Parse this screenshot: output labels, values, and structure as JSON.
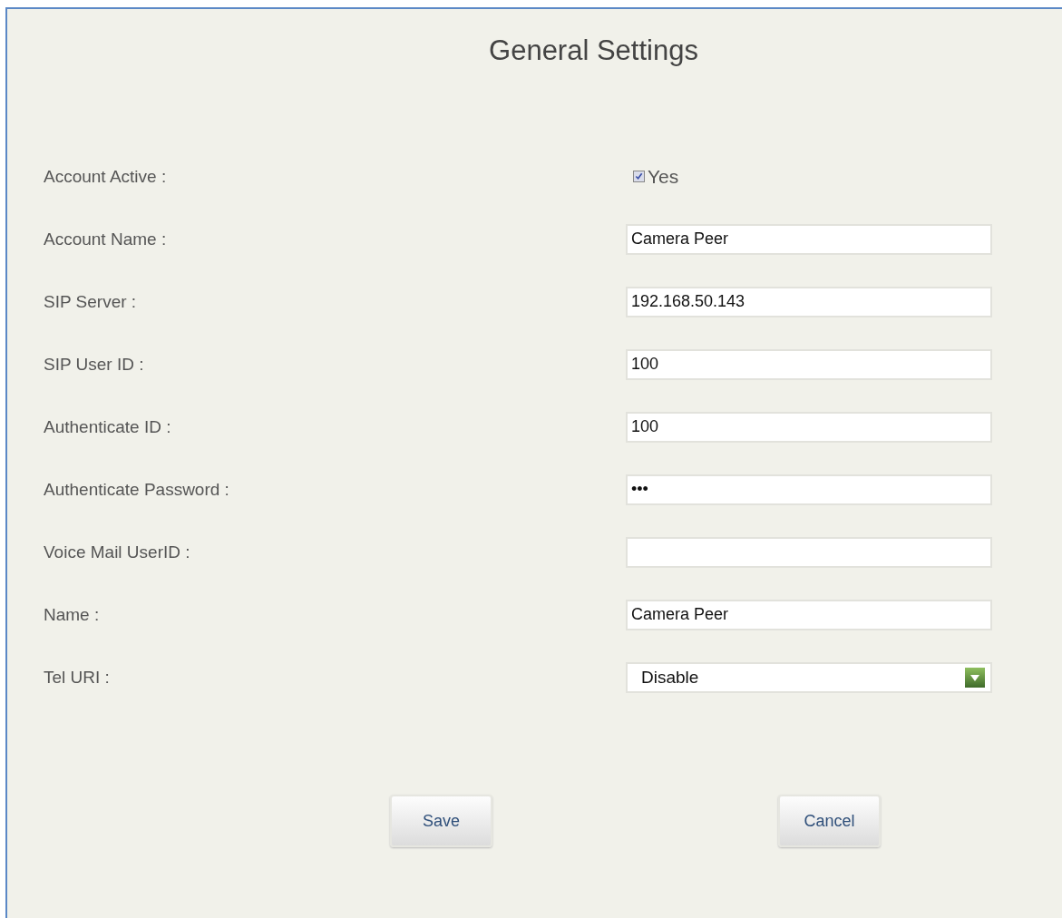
{
  "title": "General Settings",
  "fields": [
    {
      "kind": "checkbox",
      "label": "Account Active :",
      "checked": true,
      "value": "Yes"
    },
    {
      "kind": "text",
      "label": "Account Name :",
      "value": "Camera Peer"
    },
    {
      "kind": "text",
      "label": "SIP Server :",
      "value": "192.168.50.143"
    },
    {
      "kind": "text",
      "label": "SIP User ID :",
      "value": "100"
    },
    {
      "kind": "text",
      "label": "Authenticate ID :",
      "value": "100"
    },
    {
      "kind": "text",
      "label": "Authenticate Password :",
      "value": "•••"
    },
    {
      "kind": "text",
      "label": "Voice Mail UserID :"
    },
    {
      "kind": "text",
      "label": "Name :",
      "value": "Camera Peer"
    },
    {
      "kind": "select",
      "label": "Tel URI :",
      "value": "Disable"
    }
  ],
  "buttons": [
    "Save",
    "Cancel"
  ]
}
